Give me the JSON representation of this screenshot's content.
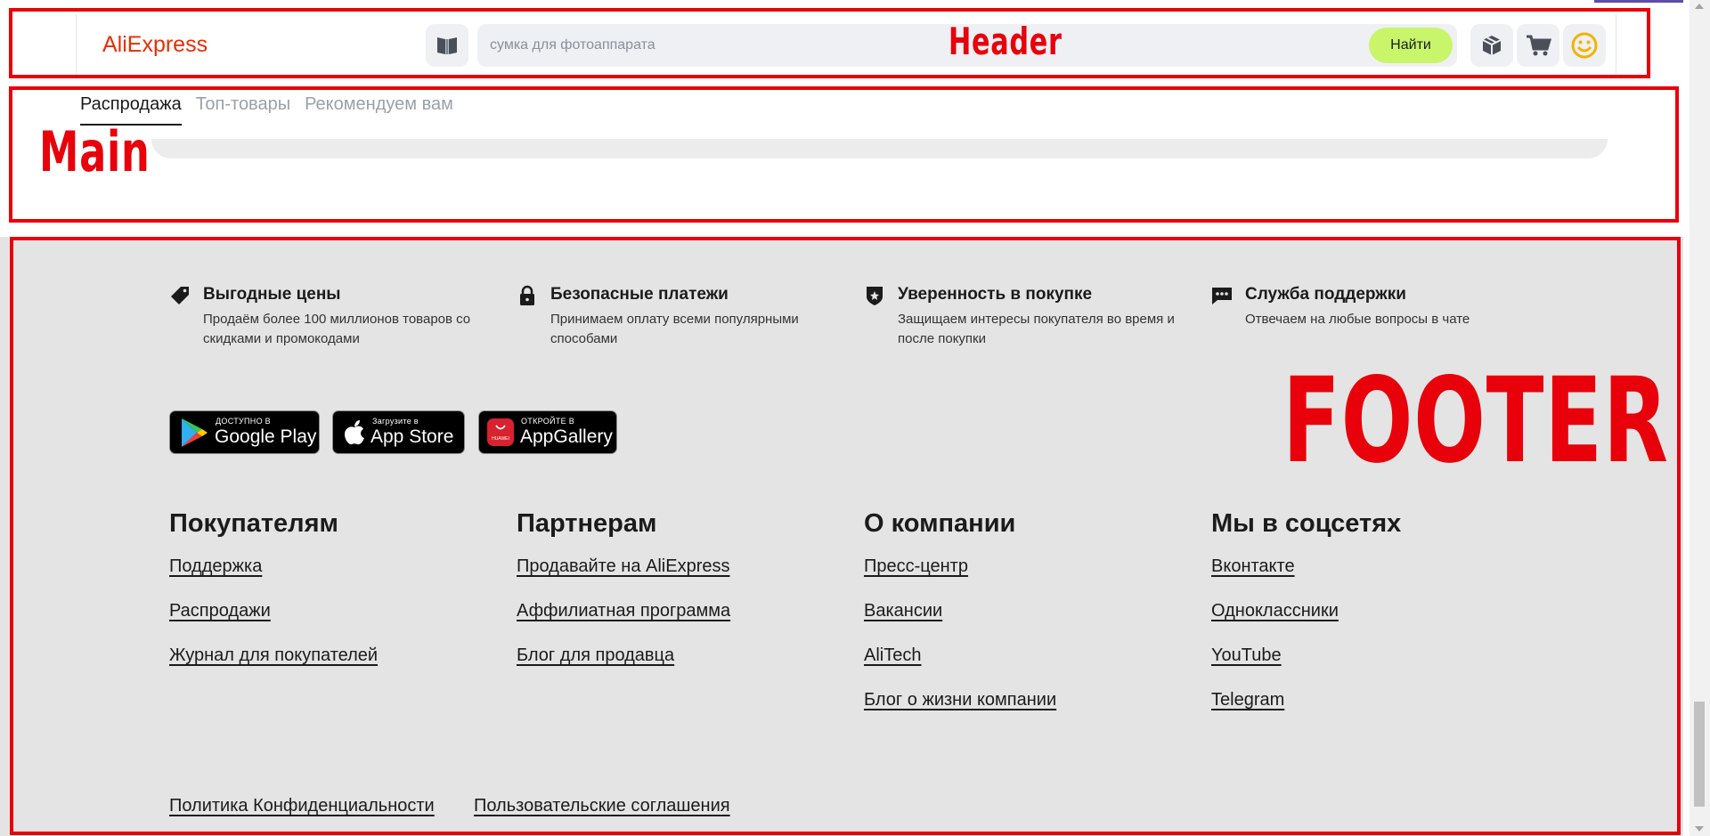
{
  "annotations": {
    "header": "Header",
    "main": "Main",
    "footer": "FOOTER"
  },
  "header": {
    "logo": "AliExpress",
    "catalog_icon": "open-book-icon",
    "search_placeholder": "сумка для фотоаппарата",
    "search_button": "Найти",
    "icons": [
      "package-icon",
      "cart-icon",
      "smiley-icon"
    ]
  },
  "main": {
    "tabs": [
      {
        "label": "Распродажа",
        "active": true
      },
      {
        "label": "Топ-товары",
        "active": false
      },
      {
        "label": "Рекомендуем вам",
        "active": false
      }
    ]
  },
  "footer": {
    "features": [
      {
        "icon": "tag-icon",
        "title": "Выгодные цены",
        "desc": "Продаём более 100 миллионов товаров со скидками и промокодами"
      },
      {
        "icon": "lock-icon",
        "title": "Безопасные платежи",
        "desc": "Принимаем оплату всеми популярными способами"
      },
      {
        "icon": "shield-icon",
        "title": "Уверенность в покупке",
        "desc": "Защищаем интересы покупателя во время и после покупки"
      },
      {
        "icon": "chat-icon",
        "title": "Служба поддержки",
        "desc": "Отвечаем на любые вопросы в чате"
      }
    ],
    "stores": [
      {
        "small": "ДОСТУПНО В",
        "big": "Google Play"
      },
      {
        "small": "Загрузите в",
        "big": "App Store"
      },
      {
        "small": "ОТКРОЙТЕ В",
        "big": "AppGallery",
        "brand": "HUAWEI"
      }
    ],
    "columns": [
      {
        "title": "Покупателям",
        "links": [
          "Поддержка",
          "Распродажи",
          "Журнал для покупателей"
        ]
      },
      {
        "title": "Партнерам",
        "links": [
          "Продавайте на AliExpress",
          "Аффилиатная программа",
          "Блог для продавца"
        ]
      },
      {
        "title": "О компании",
        "links": [
          "Пресс-центр",
          "Вакансии",
          "AliTech",
          "Блог о жизни компании"
        ]
      },
      {
        "title": "Мы в соцсетях",
        "links": [
          "Вконтакте",
          "Одноклассники",
          "YouTube",
          "Telegram"
        ]
      }
    ],
    "bottom_links": [
      "Политика Конфиденциальности",
      "Пользовательские соглашения"
    ]
  },
  "colors": {
    "annotation": "#e8000b",
    "brand": "#e62e04",
    "search_button": "#c8f56a",
    "footer_bg": "#e4e4e4"
  }
}
